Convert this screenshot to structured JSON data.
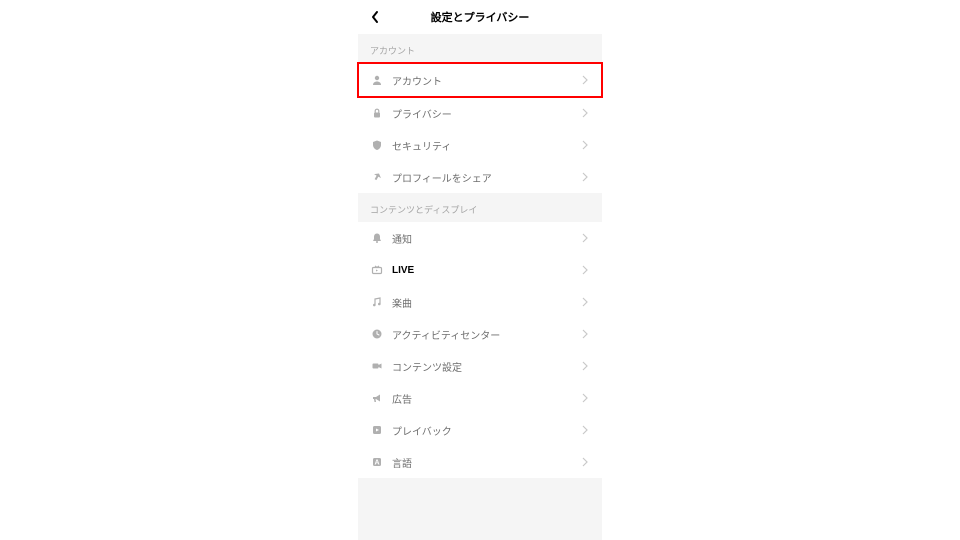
{
  "header": {
    "title": "設定とプライバシー"
  },
  "sections": {
    "account": {
      "header": "アカウント",
      "items": {
        "account": "アカウント",
        "privacy": "プライバシー",
        "security": "セキュリティ",
        "share_profile": "プロフィールをシェア"
      }
    },
    "content_display": {
      "header": "コンテンツとディスプレイ",
      "items": {
        "notifications": "通知",
        "live": "LIVE",
        "music": "楽曲",
        "activity_center": "アクティビティセンター",
        "content_settings": "コンテンツ設定",
        "ads": "広告",
        "playback": "プレイバック",
        "language": "言語"
      }
    }
  }
}
